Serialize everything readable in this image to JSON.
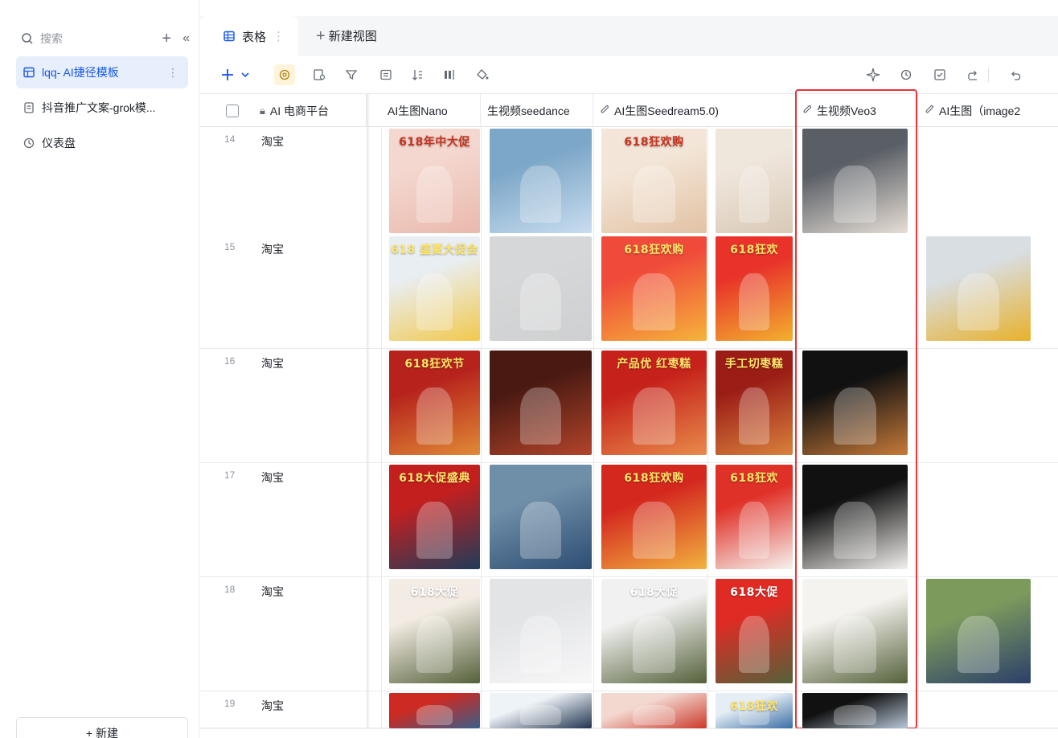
{
  "sidebar": {
    "search_label": "搜索",
    "items": [
      {
        "label": "lqq- AI捷径模板",
        "icon": "table-icon",
        "active": true
      },
      {
        "label": "抖音推广文案-grok模...",
        "icon": "doc-icon",
        "active": false
      },
      {
        "label": "仪表盘",
        "icon": "dashboard-icon",
        "active": false
      }
    ],
    "new_button": "+ 新建"
  },
  "tabs": {
    "active_label": "表格",
    "new_view_label": "新建视图"
  },
  "columns": [
    {
      "label": "AI 电商平台",
      "icon": "lock-ai-icon"
    },
    {
      "label": "AI生图Nano",
      "icon": ""
    },
    {
      "label": "生视频seedance",
      "icon": ""
    },
    {
      "label": "AI生图Seedream5.0)",
      "icon": "attachment-icon"
    },
    {
      "label": "生视频Veo3",
      "icon": "attachment-icon"
    },
    {
      "label": "AI生图（image2",
      "icon": "attachment-icon"
    }
  ],
  "rows": [
    {
      "num": "14",
      "platform": "淘宝"
    },
    {
      "num": "15",
      "platform": "淘宝"
    },
    {
      "num": "16",
      "platform": "淘宝"
    },
    {
      "num": "17",
      "platform": "淘宝"
    },
    {
      "num": "18",
      "platform": "淘宝"
    },
    {
      "num": "19",
      "platform": "淘宝"
    }
  ],
  "thumb_captions": {
    "r14": [
      "618年中大促",
      "",
      "618狂欢购",
      "",
      "",
      ""
    ],
    "r15": [
      "618 盛夏大促会",
      "",
      "618狂欢购",
      "618狂欢",
      "",
      ""
    ],
    "r16": [
      "618狂欢节",
      "",
      "产品优 红枣糕",
      "手工切枣糕",
      "",
      ""
    ],
    "r17": [
      "618大促盛典",
      "",
      "618狂欢购",
      "618狂欢",
      "",
      ""
    ],
    "r18": [
      "618大促",
      "",
      "618大促",
      "618大促",
      "",
      ""
    ],
    "r19": [
      "",
      "",
      "",
      "618狂欢",
      "",
      ""
    ]
  },
  "colors": {
    "accent": "#1456f0",
    "highlight_border": "#e5373b",
    "active_nav_bg": "#e8effc"
  }
}
